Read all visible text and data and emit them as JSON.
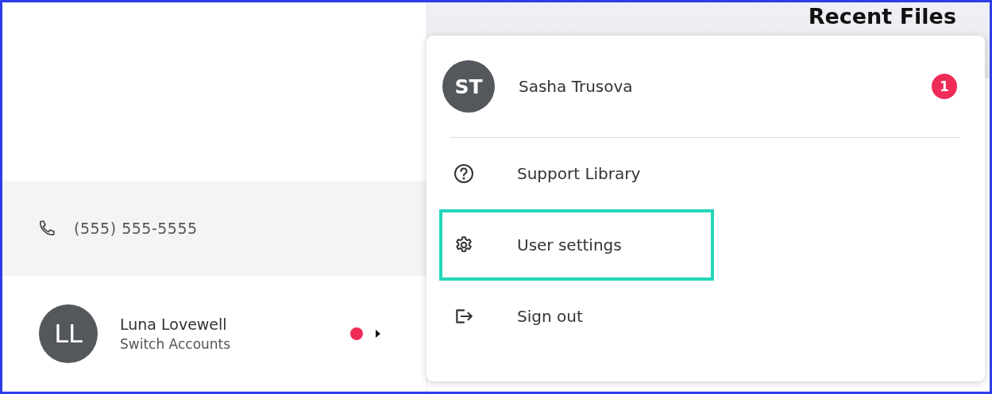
{
  "sidebar": {
    "phone": "(555) 555-5555",
    "account": {
      "initials": "LL",
      "name": "Luna Lovewell",
      "subtitle": "Switch Accounts",
      "notification": true
    }
  },
  "main": {
    "title": "Recent Files"
  },
  "menu": {
    "user": {
      "initials": "ST",
      "name": "Sasha Trusova",
      "badge": "1"
    },
    "items": [
      {
        "kind": "help",
        "label": "Support Library",
        "highlighted": false
      },
      {
        "kind": "settings",
        "label": "User settings",
        "highlighted": true
      },
      {
        "kind": "signout",
        "label": "Sign out",
        "highlighted": false
      }
    ]
  }
}
